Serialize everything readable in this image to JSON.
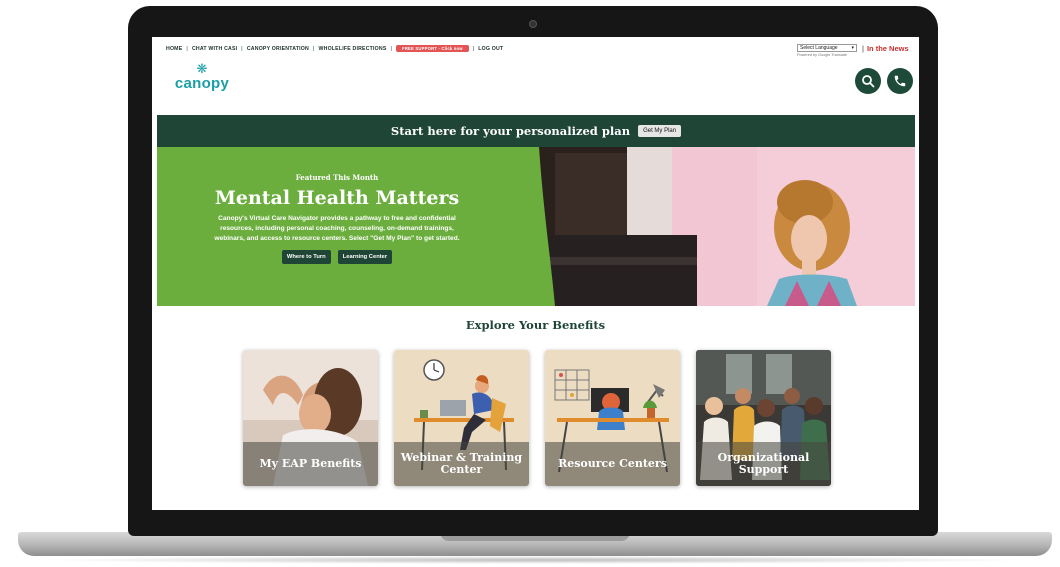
{
  "topnav": {
    "items": [
      "HOME",
      "CHAT WITH CASI",
      "CANOPY ORIENTATION",
      "WHOLELIFE DIRECTIONS"
    ],
    "support_pill": "FREE SUPPORT - Click now",
    "logout": "LOG OUT"
  },
  "language": {
    "selected": "Select Language",
    "powered_by": "Powered by Google Translate"
  },
  "news_link": "In the News",
  "logo": {
    "text": "canopy",
    "icon": "snowflake-flower-icon"
  },
  "actions": {
    "search_icon": "search-icon",
    "phone_icon": "phone-icon"
  },
  "cta": {
    "text": "Start here for your personalized plan",
    "button": "Get My Plan"
  },
  "hero": {
    "eyebrow": "Featured This Month",
    "title": "Mental Health Matters",
    "description": "Canopy's Virtual Care Navigator provides a pathway to free and confidential resources, including personal coaching, counseling, on-demand trainings, webinars, and access to resource centers. Select \"Get My Plan\" to get started.",
    "buttons": [
      "Where to Turn",
      "Learning Center"
    ]
  },
  "explore": {
    "heading": "Explore Your Benefits",
    "cards": [
      {
        "label": "My EAP Benefits"
      },
      {
        "label": "Webinar & Training\nCenter"
      },
      {
        "label": "Resource Centers"
      },
      {
        "label": "Organizational\nSupport"
      }
    ]
  },
  "colors": {
    "brand_dark_green": "#1f4537",
    "hero_green": "#6cae3e",
    "logo_teal": "#1b9fa6",
    "news_red": "#c62f2f",
    "pill_red": "#e35454"
  }
}
